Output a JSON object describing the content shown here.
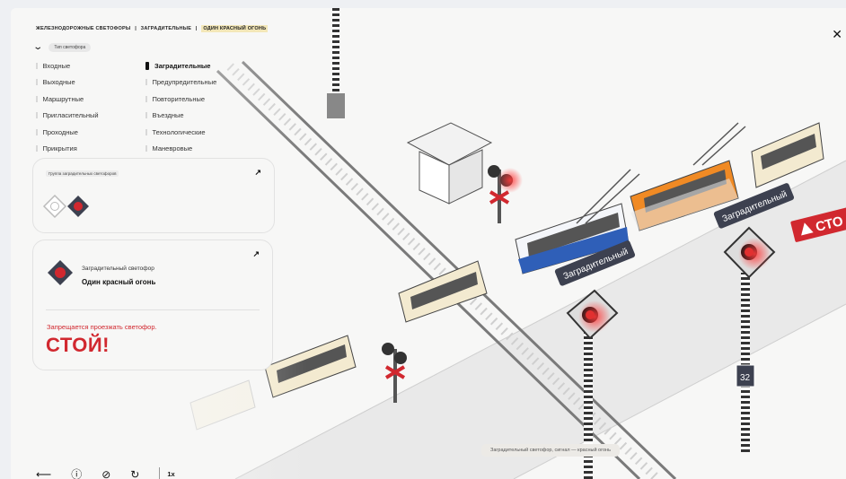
{
  "breadcrumb": {
    "part1": "ЖЕЛЕЗНОДОРОЖНЫЕ СВЕТОФОРЫ",
    "part2": "ЗАГРАДИТЕЛЬНЫЕ",
    "part3": "ОДИН КРАСНЫЙ ОГОНЬ",
    "separator": "|"
  },
  "type_toggle": {
    "label": "Тип светофора"
  },
  "categories_left": [
    "Входные",
    "Выходные",
    "Маршрутные",
    "Пригласительный",
    "Проходные",
    "Прикрытия"
  ],
  "categories_right": [
    {
      "label": "Заградительные",
      "active": true
    },
    {
      "label": "Предупредительные",
      "active": false
    },
    {
      "label": "Повторительные",
      "active": false
    },
    {
      "label": "Въездные",
      "active": false
    },
    {
      "label": "Технологические",
      "active": false
    },
    {
      "label": "Маневровые",
      "active": false
    }
  ],
  "group_card": {
    "title": "Группа заградительных светофоров"
  },
  "info_card": {
    "type_label": "Заградительный светофор",
    "signal_label": "Один красный огонь",
    "warning": "Запрещается проезжать светофор.",
    "command": "СТОЙ!"
  },
  "controls": {
    "speed": "1x"
  },
  "caption": "Заградительный светофор, сигнал — красный огонь",
  "scene_signs": {
    "sign1": "Заградительный",
    "sign2": "Заградительный",
    "stop_sign": "СТО",
    "plate_number": "32"
  },
  "icons": [
    "close-icon",
    "chevron-down-icon",
    "back-arrow-icon",
    "info-icon",
    "mute-icon",
    "restart-icon",
    "arrow-up-right-icon"
  ],
  "colors": {
    "accent_red": "#d1282f",
    "highlight": "#f3e7b8",
    "bus_orange": "#f08a24",
    "trolleybus_blue": "#2f5fb8"
  }
}
